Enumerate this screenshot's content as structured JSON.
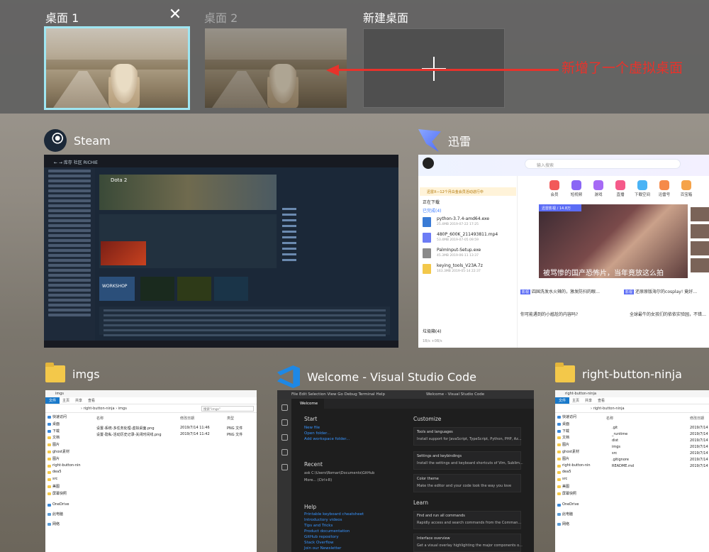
{
  "desktops": {
    "desk1_label": "桌面 1",
    "desk2_label": "桌面 2",
    "new_label": "新建桌面",
    "close_glyph": "✕",
    "annotation": "新增了一个虚拟桌面",
    "annotation_color": "#e8322b",
    "active_outline": "#9fe6f2"
  },
  "windows": {
    "steam": {
      "title": "Steam",
      "bar_text": "← →  库存  社区  RICHIE",
      "game": "Dota 2",
      "workshop": "WORKSHOP"
    },
    "xunlei": {
      "title": "迅雷",
      "search_placeholder": "输入搜索",
      "notice": "迅雷X—12个月白金会员活动进行中",
      "section_downloading": "正在下载",
      "section_done": "已完成(4)",
      "section_recycle": "垃圾箱(4)",
      "downloads": [
        {
          "name": "python-3.7.4-amd64.exe",
          "meta": "25.4MB   2019-07-22 17:25"
        },
        {
          "name": "480P_600K_211493811.mp4",
          "meta": "53.4MB   2019-07-05 09:59"
        },
        {
          "name": "PalmInput-Setup.exe",
          "meta": "45.3MB   2019-06-11 13:37"
        },
        {
          "name": "keying_tools_V23A.7z",
          "meta": "163.3MB   2019-05-14 22:37"
        }
      ],
      "footer_meta": "1B/s  +0B/s",
      "nav_icons": [
        "会员",
        "短视频",
        "游戏",
        "直播",
        "下载空间",
        "迅雷号",
        "百宝箱"
      ],
      "video_tag": "迅雷影视 / 14.8万",
      "video_caption": "被骂惨的国产恐怖片，当年竟放这么拍",
      "news": [
        {
          "badge": "影视",
          "text": "四国洗发水火辣的，激发防扫的眼…"
        },
        {
          "badge": "影视",
          "text": "还原原版海尔的cosplay! 竟好…"
        },
        {
          "badge": "",
          "text": "你可能遇到的小尴尬的内容吗?"
        },
        {
          "badge": "",
          "text": "全球最牛的女孩们的依依实验园，不错…"
        }
      ]
    },
    "imgs": {
      "title": "imgs",
      "window_title": "imgs",
      "tabs": [
        "文件",
        "主页",
        "共享",
        "查看"
      ],
      "path": "› right-button-ninja › imgs",
      "search": "搜索\"imgs\"",
      "nav": [
        "快速访问",
        "桌面",
        "下载",
        "文档",
        "图片",
        "ghost素材",
        "图片",
        "right-button-nin",
        "dea5",
        "src",
        "美图",
        "屏幕快照",
        "OneDrive",
        "此电脑",
        "网络"
      ],
      "headers": [
        "名称",
        "修改日期",
        "类型"
      ],
      "files": [
        {
          "name": "设置-系统-多任务处理-虚拟桌面.png",
          "date": "2019/7/14 11:46",
          "type": "PNG 文件"
        },
        {
          "name": "设置-隐私-活动历史记录-关闭时间线.png",
          "date": "2019/7/14 11:42",
          "type": "PNG 文件"
        }
      ]
    },
    "vscode": {
      "title": "Welcome - Visual Studio Code",
      "menu": "File  Edit  Selection  View  Go  Debug  Terminal  Help",
      "window_title": "Welcome - Visual Studio Code",
      "tab": "Welcome",
      "start_h": "Start",
      "start_links": [
        "New file",
        "Open folder...",
        "Add workspace folder..."
      ],
      "recent_h": "Recent",
      "recent": [
        "ask   C:\\Users\\Roman\\Documents\\GitHub",
        "More...   (Ctrl+R)"
      ],
      "help_h": "Help",
      "help_links": [
        "Printable keyboard cheatsheet",
        "Introductory videos",
        "Tips and Tricks",
        "Product documentation",
        "GitHub repository",
        "Stack Overflow",
        "Join our Newsletter"
      ],
      "customize_h": "Customize",
      "cards": [
        {
          "t": "Tools and languages",
          "d": "Install support for JavaScript, TypeScript, Python, PHP, Az..."
        },
        {
          "t": "Settings and keybindings",
          "d": "Install the settings and keyboard shortcuts of Vim, Sublim..."
        },
        {
          "t": "Color theme",
          "d": "Make the editor and your code look the way you love"
        }
      ],
      "learn_h": "Learn",
      "learn": [
        {
          "t": "Find and run all commands",
          "d": "Rapidly access and search commands from the Comman..."
        },
        {
          "t": "Interface overview",
          "d": "Get a visual overlay highlighting the major components o..."
        }
      ]
    },
    "ninja": {
      "title": "right-button-ninja",
      "window_title": "right-button-ninja",
      "tabs": [
        "文件",
        "主页",
        "共享",
        "查看"
      ],
      "path": "› right-button-ninja",
      "nav": [
        "快速访问",
        "桌面",
        "下载",
        "文档",
        "图片",
        "ghost素材",
        "图片",
        "right-button-nin",
        "dea5",
        "src",
        "美图",
        "屏幕快照",
        "OneDrive",
        "此电脑",
        "网络"
      ],
      "headers": [
        "名称",
        "修改日期"
      ],
      "files": [
        {
          "name": ".git",
          "date": "2019/7/14"
        },
        {
          "name": "_runtime",
          "date": "2019/7/14"
        },
        {
          "name": "dist",
          "date": "2019/7/14"
        },
        {
          "name": "imgs",
          "date": "2019/7/14"
        },
        {
          "name": "src",
          "date": "2019/7/14"
        },
        {
          "name": ".gitignore",
          "date": "2019/7/14"
        },
        {
          "name": "README.md",
          "date": "2019/7/14"
        }
      ]
    }
  }
}
